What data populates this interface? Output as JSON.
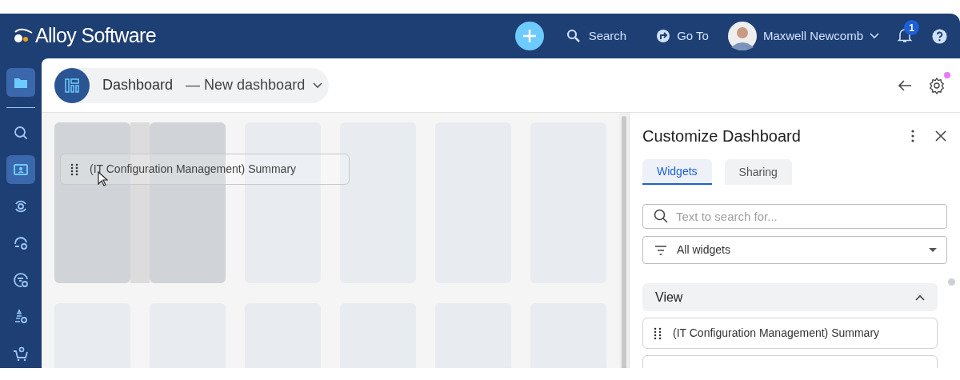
{
  "header": {
    "logo_text": "Alloy Software",
    "search_label": "Search",
    "goto_label": "Go To",
    "user_name": "Maxwell Newcomb",
    "notification_count": "1"
  },
  "sidebar": {
    "items": [
      {
        "kind": "folder",
        "selected": true
      },
      {
        "kind": "search",
        "selected": false
      },
      {
        "kind": "ticket",
        "selected": true
      },
      {
        "kind": "cycle",
        "selected": false
      },
      {
        "kind": "cloud",
        "selected": false
      },
      {
        "kind": "flow",
        "selected": false
      },
      {
        "kind": "pyramid",
        "selected": false
      },
      {
        "kind": "cart",
        "selected": false
      }
    ]
  },
  "toolbar": {
    "title": "Dashboard",
    "dashboard_name": "— New dashboard",
    "settings_changed": true
  },
  "canvas": {
    "drag_item_label": "(IT Configuration Management) Summary",
    "rows": [
      [
        {
          "drop_target": true
        },
        {
          "drop_target": true
        },
        {
          "drop_target": false
        },
        {
          "drop_target": false
        },
        {
          "drop_target": false
        },
        {
          "drop_target": false
        }
      ],
      [
        {
          "drop_target": false
        },
        {
          "drop_target": false
        },
        {
          "drop_target": false
        },
        {
          "drop_target": false
        },
        {
          "drop_target": false
        },
        {
          "drop_target": false
        }
      ]
    ]
  },
  "panel": {
    "title": "Customize Dashboard",
    "tabs": [
      {
        "label": "Widgets",
        "selected": true
      },
      {
        "label": "Sharing",
        "selected": false
      }
    ],
    "search": {
      "placeholder": "Text to search for..."
    },
    "filter": {
      "value": "All widgets"
    },
    "section": {
      "title": "View",
      "expanded": true,
      "items": [
        {
          "label": "(IT Configuration Management) Summary"
        },
        {
          "kind": "cut"
        }
      ]
    }
  }
}
